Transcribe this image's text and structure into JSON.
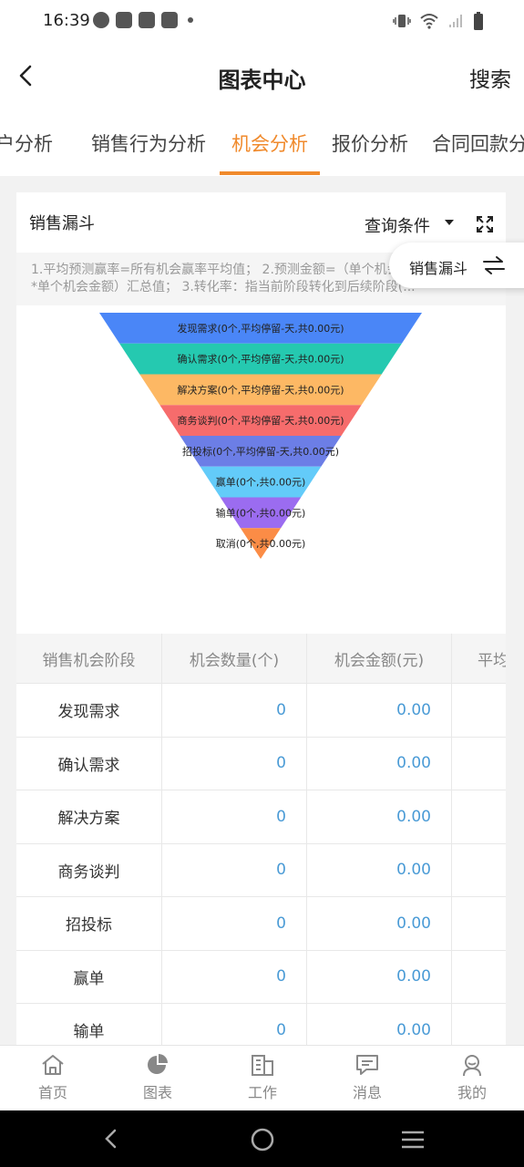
{
  "status_bar": {
    "time": "16:39"
  },
  "header": {
    "title": "图表中心",
    "search_label": "搜索"
  },
  "tabs": [
    {
      "label": "户分析"
    },
    {
      "label": "销售行为分析"
    },
    {
      "label": "机会分析",
      "active": true
    },
    {
      "label": "报价分析"
    },
    {
      "label": "合同回款分析"
    }
  ],
  "card": {
    "title": "销售漏斗",
    "query_label": "查询条件",
    "note_line1": "1.平均预测赢率=所有机会赢率平均值； 2.预测金额=（单个机会赢率",
    "note_line2": "*单个机会金额）汇总值； 3.转化率：指当前阶段转化到后续阶段(..."
  },
  "chart_data": {
    "type": "funnel",
    "stages": [
      {
        "label": "发现需求(0个,平均停留-天,共0.00元)",
        "value": 0,
        "color": "#4a86f7"
      },
      {
        "label": "确认需求(0个,平均停留-天,共0.00元)",
        "value": 0,
        "color": "#25c9b0"
      },
      {
        "label": "解决方案(0个,平均停留-天,共0.00元)",
        "value": 0,
        "color": "#fdb864"
      },
      {
        "label": "商务谈判(0个,平均停留-天,共0.00元)",
        "value": 0,
        "color": "#f66c6c"
      },
      {
        "label": "招投标(0个,平均停留-天,共0.00元)",
        "value": 0,
        "color": "#6c7ee6"
      },
      {
        "label": "赢单(0个,共0.00元)",
        "value": 0,
        "color": "#63cbf9"
      },
      {
        "label": "输单(0个,共0.00元)",
        "value": 0,
        "color": "#9b6cf0"
      },
      {
        "label": "取消(0个,共0.00元)",
        "value": 0,
        "color": "#fb8c46"
      }
    ]
  },
  "table": {
    "headers": [
      "销售机会阶段",
      "机会数量(个)",
      "机会金额(元)",
      "平均"
    ],
    "rows": [
      [
        "发现需求",
        "0",
        "0.00",
        ""
      ],
      [
        "确认需求",
        "0",
        "0.00",
        ""
      ],
      [
        "解决方案",
        "0",
        "0.00",
        ""
      ],
      [
        "商务谈判",
        "0",
        "0.00",
        ""
      ],
      [
        "招投标",
        "0",
        "0.00",
        ""
      ],
      [
        "赢单",
        "0",
        "0.00",
        ""
      ],
      [
        "输单",
        "0",
        "0.00",
        ""
      ]
    ]
  },
  "floating_chip": {
    "label": "销售漏斗"
  },
  "bottom_nav": [
    {
      "label": "首页",
      "icon": "home-icon"
    },
    {
      "label": "图表",
      "icon": "pie-chart-icon",
      "active": true
    },
    {
      "label": "工作",
      "icon": "work-icon"
    },
    {
      "label": "消息",
      "icon": "message-icon"
    },
    {
      "label": "我的",
      "icon": "profile-icon"
    }
  ]
}
